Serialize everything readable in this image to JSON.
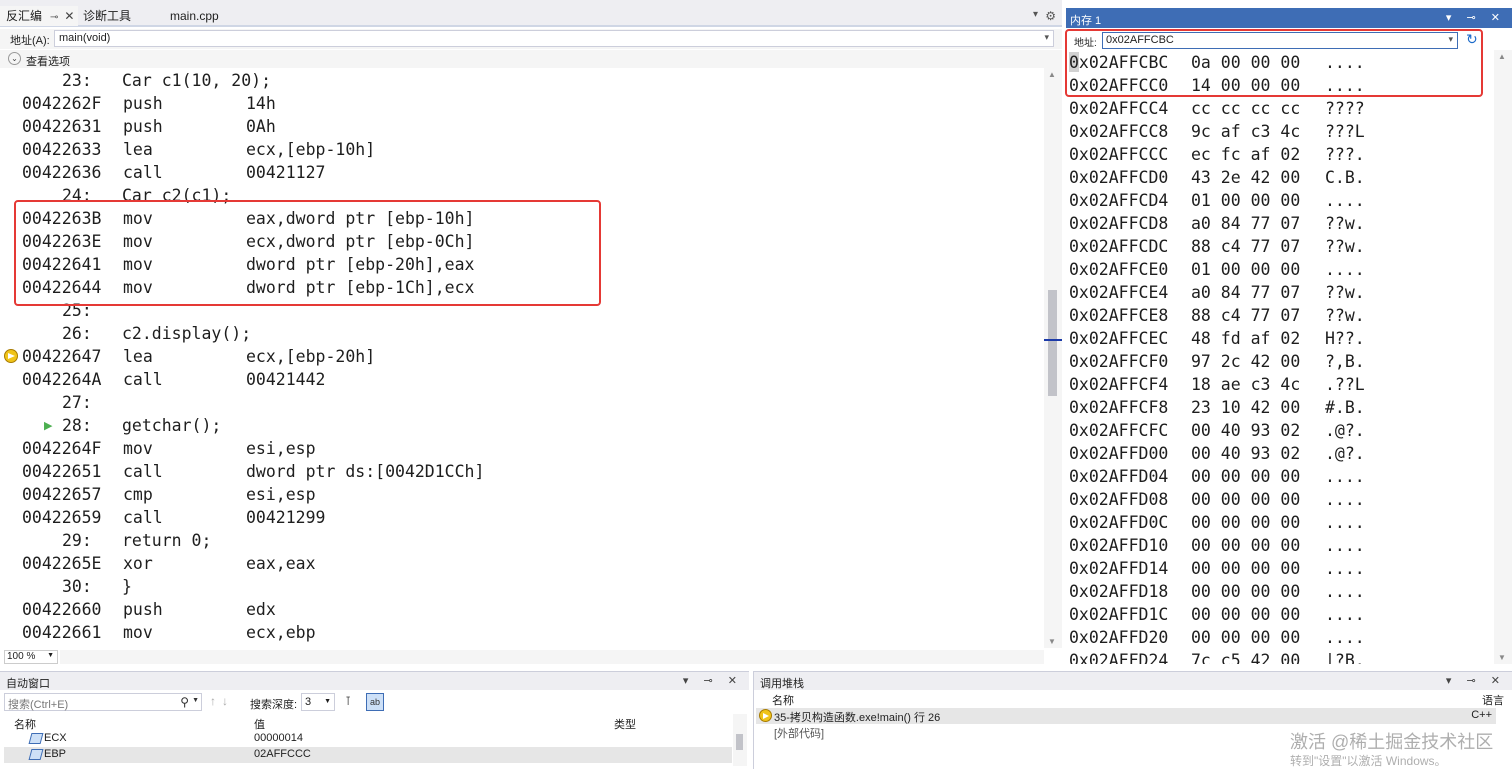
{
  "tabs": [
    {
      "label": "反汇编",
      "active": true
    },
    {
      "label": "诊断工具",
      "active": false
    },
    {
      "label": "main.cpp",
      "active": false
    }
  ],
  "address_bar": {
    "label": "地址(A):",
    "value": "main(void)"
  },
  "view_options": "查看选项",
  "disasm": [
    {
      "type": "src",
      "num": "23:",
      "text": "Car c1(10, 20);"
    },
    {
      "type": "asm",
      "addr": "0042262F",
      "op": "push",
      "args": "14h"
    },
    {
      "type": "asm",
      "addr": "00422631",
      "op": "push",
      "args": "0Ah"
    },
    {
      "type": "asm",
      "addr": "00422633",
      "op": "lea",
      "args": "ecx,[ebp-10h]"
    },
    {
      "type": "asm",
      "addr": "00422636",
      "op": "call",
      "args": "00421127"
    },
    {
      "type": "src",
      "num": "24:",
      "text": "Car c2(c1);"
    },
    {
      "type": "asm",
      "addr": "0042263B",
      "op": "mov",
      "args": "eax,dword ptr [ebp-10h]"
    },
    {
      "type": "asm",
      "addr": "0042263E",
      "op": "mov",
      "args": "ecx,dword ptr [ebp-0Ch]"
    },
    {
      "type": "asm",
      "addr": "00422641",
      "op": "mov",
      "args": "dword ptr [ebp-20h],eax"
    },
    {
      "type": "asm",
      "addr": "00422644",
      "op": "mov",
      "args": "dword ptr [ebp-1Ch],ecx"
    },
    {
      "type": "src",
      "num": "25:",
      "text": ""
    },
    {
      "type": "src",
      "num": "26:",
      "text": "c2.display();"
    },
    {
      "type": "asm",
      "addr": "00422647",
      "op": "lea",
      "args": "ecx,[ebp-20h]"
    },
    {
      "type": "asm",
      "addr": "0042264A",
      "op": "call",
      "args": "00421442"
    },
    {
      "type": "src",
      "num": "27:",
      "text": ""
    },
    {
      "type": "src",
      "num": "28:",
      "text": "getchar();"
    },
    {
      "type": "asm",
      "addr": "0042264F",
      "op": "mov",
      "args": "esi,esp"
    },
    {
      "type": "asm",
      "addr": "00422651",
      "op": "call",
      "args": "dword ptr ds:[0042D1CCh]"
    },
    {
      "type": "asm",
      "addr": "00422657",
      "op": "cmp",
      "args": "esi,esp"
    },
    {
      "type": "asm",
      "addr": "00422659",
      "op": "call",
      "args": "00421299"
    },
    {
      "type": "src",
      "num": "29:",
      "text": "return 0;"
    },
    {
      "type": "asm",
      "addr": "0042265E",
      "op": "xor",
      "args": "eax,eax"
    },
    {
      "type": "src",
      "num": "30:",
      "text": "}"
    },
    {
      "type": "asm",
      "addr": "00422660",
      "op": "push",
      "args": "edx"
    },
    {
      "type": "asm",
      "addr": "00422661",
      "op": "mov",
      "args": "ecx,ebp"
    }
  ],
  "current_line_index": 12,
  "step_line_index": 15,
  "zoom": "100 %",
  "memory": {
    "title": "内存 1",
    "address_label": "地址:",
    "address_value": "0x02AFFCBC",
    "rows": [
      {
        "addr": "0x02AFFCBC",
        "bytes": "0a 00 00 00",
        "ascii": "...."
      },
      {
        "addr": "0x02AFFCC0",
        "bytes": "14 00 00 00",
        "ascii": "...."
      },
      {
        "addr": "0x02AFFCC4",
        "bytes": "cc cc cc cc",
        "ascii": "????"
      },
      {
        "addr": "0x02AFFCC8",
        "bytes": "9c af c3 4c",
        "ascii": "???L"
      },
      {
        "addr": "0x02AFFCCC",
        "bytes": "ec fc af 02",
        "ascii": "???."
      },
      {
        "addr": "0x02AFFCD0",
        "bytes": "43 2e 42 00",
        "ascii": "C.B."
      },
      {
        "addr": "0x02AFFCD4",
        "bytes": "01 00 00 00",
        "ascii": "...."
      },
      {
        "addr": "0x02AFFCD8",
        "bytes": "a0 84 77 07",
        "ascii": "??w."
      },
      {
        "addr": "0x02AFFCDC",
        "bytes": "88 c4 77 07",
        "ascii": "??w."
      },
      {
        "addr": "0x02AFFCE0",
        "bytes": "01 00 00 00",
        "ascii": "...."
      },
      {
        "addr": "0x02AFFCE4",
        "bytes": "a0 84 77 07",
        "ascii": "??w."
      },
      {
        "addr": "0x02AFFCE8",
        "bytes": "88 c4 77 07",
        "ascii": "??w."
      },
      {
        "addr": "0x02AFFCEC",
        "bytes": "48 fd af 02",
        "ascii": "H??."
      },
      {
        "addr": "0x02AFFCF0",
        "bytes": "97 2c 42 00",
        "ascii": "?,B."
      },
      {
        "addr": "0x02AFFCF4",
        "bytes": "18 ae c3 4c",
        "ascii": ".??L"
      },
      {
        "addr": "0x02AFFCF8",
        "bytes": "23 10 42 00",
        "ascii": "#.B."
      },
      {
        "addr": "0x02AFFCFC",
        "bytes": "00 40 93 02",
        "ascii": ".@?."
      },
      {
        "addr": "0x02AFFD00",
        "bytes": "00 40 93 02",
        "ascii": ".@?."
      },
      {
        "addr": "0x02AFFD04",
        "bytes": "00 00 00 00",
        "ascii": "...."
      },
      {
        "addr": "0x02AFFD08",
        "bytes": "00 00 00 00",
        "ascii": "...."
      },
      {
        "addr": "0x02AFFD0C",
        "bytes": "00 00 00 00",
        "ascii": "...."
      },
      {
        "addr": "0x02AFFD10",
        "bytes": "00 00 00 00",
        "ascii": "...."
      },
      {
        "addr": "0x02AFFD14",
        "bytes": "00 00 00 00",
        "ascii": "...."
      },
      {
        "addr": "0x02AFFD18",
        "bytes": "00 00 00 00",
        "ascii": "...."
      },
      {
        "addr": "0x02AFFD1C",
        "bytes": "00 00 00 00",
        "ascii": "...."
      },
      {
        "addr": "0x02AFFD20",
        "bytes": "00 00 00 00",
        "ascii": "...."
      },
      {
        "addr": "0x02AFFD24",
        "bytes": "7c c5 42 00",
        "ascii": "|?B."
      }
    ]
  },
  "auto_window": {
    "title": "自动窗口",
    "search_placeholder": "搜索(Ctrl+E)",
    "depth_label": "搜索深度:",
    "depth_value": "3",
    "columns": [
      "名称",
      "值",
      "类型"
    ],
    "rows": [
      {
        "name": "ECX",
        "value": "00000014",
        "selected": false
      },
      {
        "name": "EBP",
        "value": "02AFFCCC",
        "selected": true
      }
    ]
  },
  "call_stack": {
    "title": "调用堆栈",
    "col_name": "名称",
    "col_lang": "语言",
    "rows": [
      {
        "name": "35-拷贝构造函数.exe!main() 行 26",
        "lang": "C++"
      },
      {
        "name": "[外部代码]",
        "lang": ""
      }
    ]
  },
  "watermark": "激活 @稀土掘金技术社区",
  "activate_text": "转到\"设置\"以激活 Windows。",
  "colors": {
    "highlight_box": "#e53935",
    "title_blue": "#3e6db5"
  }
}
